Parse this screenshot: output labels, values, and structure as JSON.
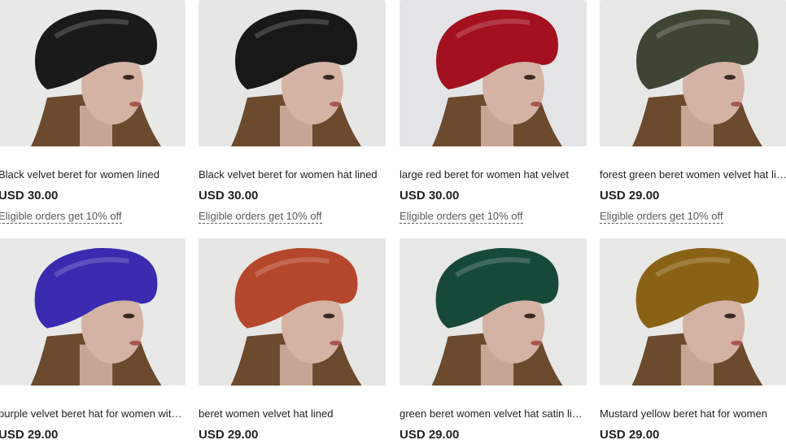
{
  "products": [
    {
      "title": "Black velvet beret for women lined",
      "price": "USD 30.00",
      "promo": "Eligible orders get 10% off",
      "hat_color": "#1a1a1a",
      "bg": "#e9e9e7",
      "hat_label": "black-velvet-beret"
    },
    {
      "title": "Black velvet beret for women hat lined",
      "price": "USD 30.00",
      "promo": "Eligible orders get 10% off",
      "hat_color": "#181818",
      "bg": "#e6e6e4",
      "hat_label": "black-velvet-beret"
    },
    {
      "title": "large red beret for women hat velvet",
      "price": "USD 30.00",
      "promo": "Eligible orders get 10% off",
      "hat_color": "#a3101f",
      "bg": "#e4e4e6",
      "hat_label": "red-velvet-beret"
    },
    {
      "title": "forest green beret women velvet hat lined",
      "price": "USD 29.00",
      "promo": "Eligible orders get 10% off",
      "hat_color": "#3e4535",
      "bg": "#e7e7e5",
      "hat_label": "forest-green-velvet-beret"
    },
    {
      "title": "purple velvet beret hat for women with lining",
      "price": "USD 29.00",
      "promo": "",
      "hat_color": "#3a2ab0",
      "bg": "#e8e8e8",
      "hat_label": "purple-velvet-beret"
    },
    {
      "title": "beret women velvet hat lined",
      "price": "USD 29.00",
      "promo": "",
      "hat_color": "#b5472c",
      "bg": "#e6e6e4",
      "hat_label": "rust-velvet-beret"
    },
    {
      "title": "green beret women velvet hat satin lined",
      "price": "USD 29.00",
      "promo": "",
      "hat_color": "#17493a",
      "bg": "#e7e7e5",
      "hat_label": "green-velvet-beret"
    },
    {
      "title": "Mustard yellow beret hat for women",
      "price": "USD 29.00",
      "promo": "",
      "hat_color": "#8a6216",
      "bg": "#e8e8e6",
      "hat_label": "mustard-velvet-beret"
    }
  ]
}
